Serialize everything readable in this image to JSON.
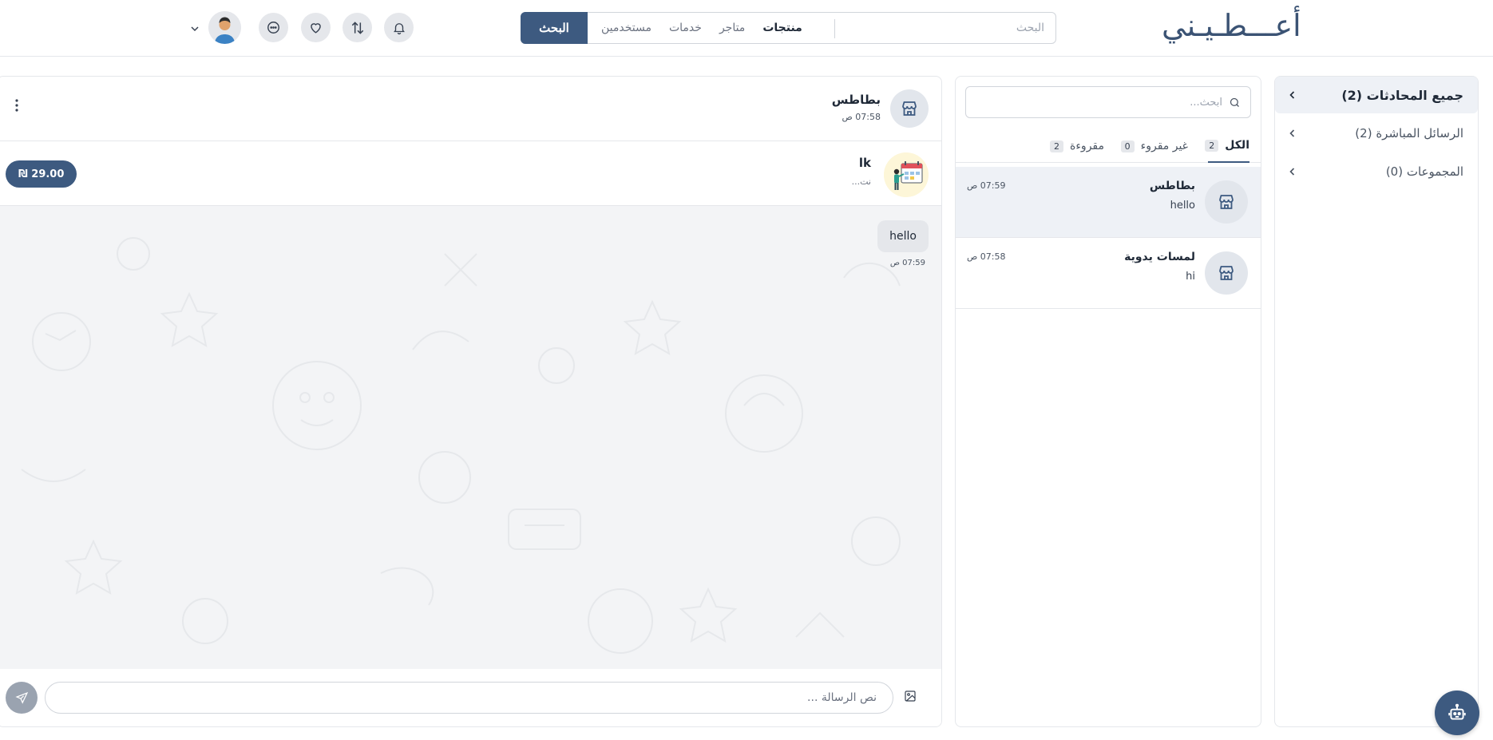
{
  "header": {
    "logo_text": "أعـــطـيـني",
    "search_placeholder": "البحث",
    "categories": [
      {
        "label": "منتجات",
        "active": true
      },
      {
        "label": "متاجر",
        "active": false
      },
      {
        "label": "خدمات",
        "active": false
      },
      {
        "label": "مستخدمين",
        "active": false
      }
    ],
    "search_button": "البحث",
    "icons": [
      "bell-icon",
      "swap-icon",
      "heart-icon",
      "chat-bubble-icon"
    ]
  },
  "sidebar": {
    "items": [
      {
        "label": "جميع المحادثات (2)",
        "active": true
      },
      {
        "label": "الرسائل المباشرة (2)",
        "active": false
      },
      {
        "label": "المجموعات (0)",
        "active": false
      }
    ]
  },
  "conversation_list": {
    "search_placeholder": "ابحث...",
    "tabs": [
      {
        "label": "الكل",
        "count": "2",
        "active": true
      },
      {
        "label": "غير مقروء",
        "count": "0",
        "active": false
      },
      {
        "label": "مقروءة",
        "count": "2",
        "active": false
      }
    ],
    "items": [
      {
        "name": "بطاطس",
        "message": "hello",
        "time": "07:59 ص",
        "active": true
      },
      {
        "name": "لمسات يدوية",
        "message": "hi",
        "time": "07:58 ص",
        "active": false
      }
    ]
  },
  "chat": {
    "header": {
      "name": "بطاطس",
      "time": "07:58 ص"
    },
    "product": {
      "name": "lk",
      "subtitle": "نت...",
      "price": "₪ 29.00"
    },
    "messages": [
      {
        "text": "hello",
        "time": "07:59 ص"
      }
    ],
    "composer_placeholder": "نص الرسالة ..."
  },
  "colors": {
    "primary": "#3d5a80",
    "active_bg": "#eef1f6",
    "chat_bg": "#f3f4f6"
  }
}
